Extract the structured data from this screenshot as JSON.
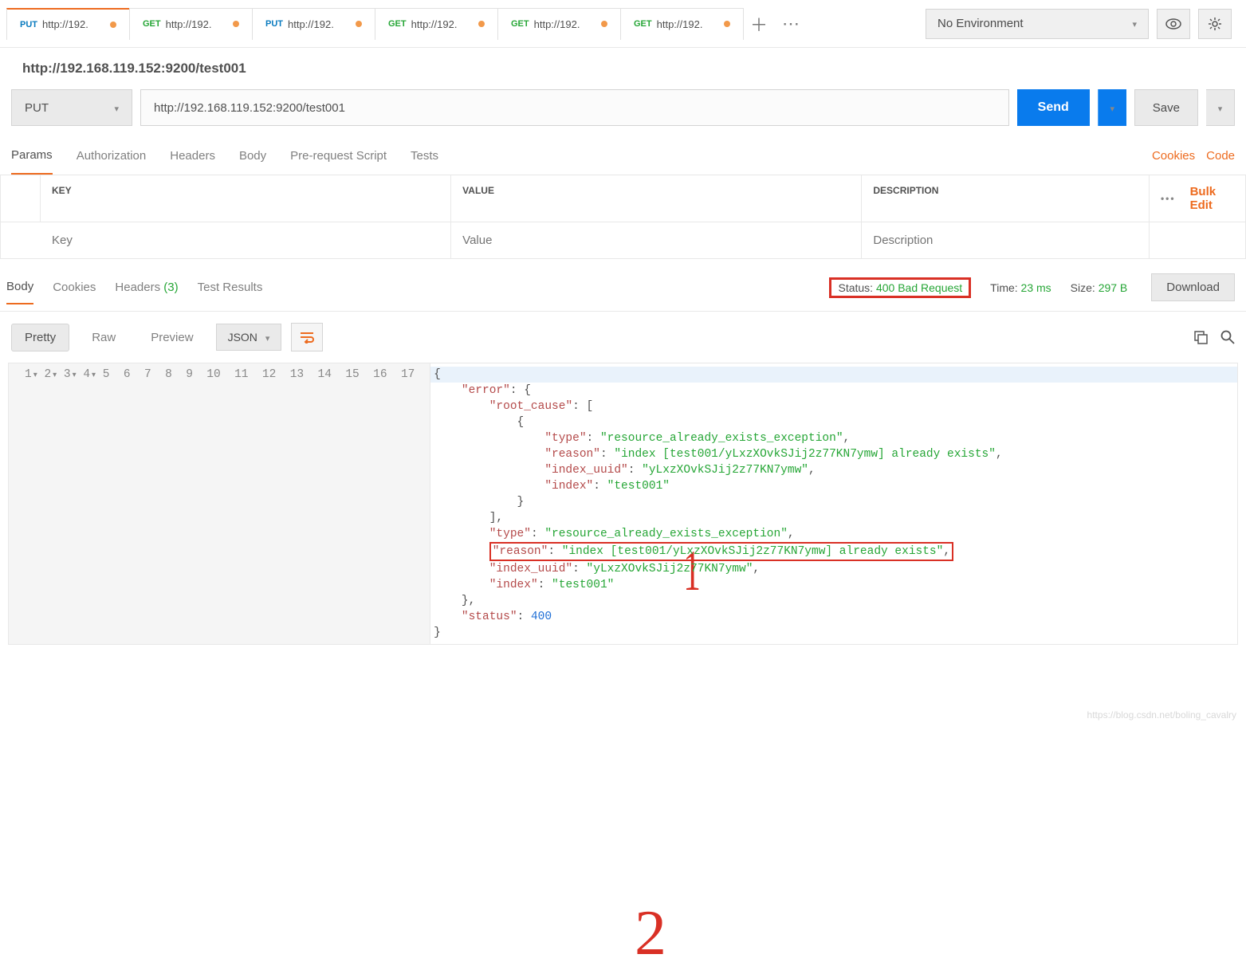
{
  "tabs": [
    {
      "method": "PUT",
      "methodClass": "method-put",
      "url": "http://192.",
      "active": true
    },
    {
      "method": "GET",
      "methodClass": "method-get",
      "url": "http://192."
    },
    {
      "method": "PUT",
      "methodClass": "method-put",
      "url": "http://192."
    },
    {
      "method": "GET",
      "methodClass": "method-get",
      "url": "http://192."
    },
    {
      "method": "GET",
      "methodClass": "method-get",
      "url": "http://192."
    },
    {
      "method": "GET",
      "methodClass": "method-get",
      "url": "http://192."
    }
  ],
  "environment": {
    "label": "No Environment"
  },
  "request": {
    "title": "http://192.168.119.152:9200/test001",
    "method": "PUT",
    "url": "http://192.168.119.152:9200/test001",
    "send": "Send",
    "save": "Save"
  },
  "reqTabs": {
    "params": "Params",
    "authorization": "Authorization",
    "headers": "Headers",
    "body": "Body",
    "prerequest": "Pre-request Script",
    "tests": "Tests",
    "cookies": "Cookies",
    "code": "Code"
  },
  "paramsTable": {
    "keyHeader": "KEY",
    "valueHeader": "VALUE",
    "descHeader": "DESCRIPTION",
    "bulkEdit": "Bulk Edit",
    "keyPlaceholder": "Key",
    "valuePlaceholder": "Value",
    "descPlaceholder": "Description"
  },
  "respTabs": {
    "body": "Body",
    "cookies": "Cookies",
    "headers": "Headers",
    "headersCount": "(3)",
    "testResults": "Test Results"
  },
  "respStatus": {
    "statusLabel": "Status:",
    "statusValue": "400 Bad Request",
    "timeLabel": "Time:",
    "timeValue": "23 ms",
    "sizeLabel": "Size:",
    "sizeValue": "297 B",
    "download": "Download"
  },
  "bodyToolbar": {
    "pretty": "Pretty",
    "raw": "Raw",
    "preview": "Preview",
    "format": "JSON"
  },
  "json": {
    "lines": [
      "1",
      "2",
      "3",
      "4",
      "5",
      "6",
      "7",
      "8",
      "9",
      "10",
      "11",
      "12",
      "13",
      "14",
      "15",
      "16",
      "17"
    ],
    "error": "error",
    "root_cause": "root_cause",
    "type": "type",
    "type_val": "resource_already_exists_exception",
    "reason": "reason",
    "reason_val": "index [test001/yLxzXOvkSJij2z77KN7ymw] already exists",
    "index_uuid": "index_uuid",
    "index_uuid_val": "yLxzXOvkSJij2z77KN7ymw",
    "index": "index",
    "index_val": "test001",
    "status": "status",
    "status_val": "400"
  },
  "annotations": {
    "one": "1",
    "two": "2"
  },
  "watermark": "https://blog.csdn.net/boling_cavalry"
}
